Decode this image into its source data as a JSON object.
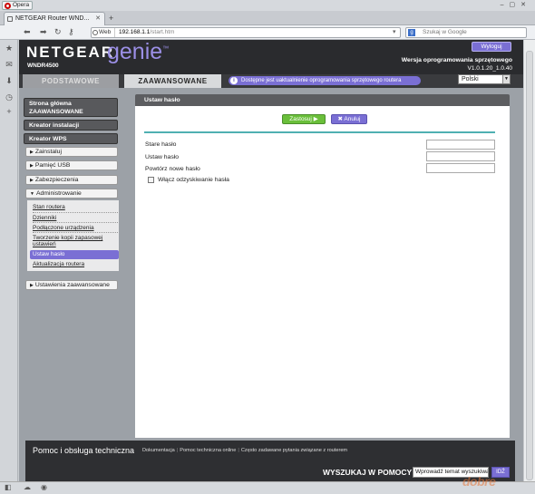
{
  "browser": {
    "menu_label": "Opera",
    "tab_title": "NETGEAR Router WND...",
    "nav_web_label": "Web",
    "url_host": "192.168.1.1",
    "url_path": "/start.htm",
    "search_placeholder": "Szukaj w Google"
  },
  "header": {
    "brand": "NETGEAR",
    "product": "genie",
    "model": "WNDR4500",
    "logout_label": "Wyloguj",
    "fw_label": "Wersja oprogramowania sprzętowego",
    "fw_version": "V1.0.1.20_1.0.40"
  },
  "tabs": {
    "basic": "PODSTAWOWE",
    "advanced": "ZAAWANSOWANE"
  },
  "update_notice": "Dostępne jest uaktualnienie oprogramowania sprzętowego routera",
  "language": "Polski",
  "sidebar": {
    "home": "Strona główna ZAAWANSOWANE",
    "setup_wizard": "Kreator instalacji",
    "wps_wizard": "Kreator WPS",
    "sections": [
      "Zainstaluj",
      "Pamięć USB",
      "Zabezpieczenia",
      "Administrowanie"
    ],
    "admin_items": [
      "Stan routera",
      "Dzienniki",
      "Podłączone urządzenia",
      "Tworzenie kopii zapasowej ustawień",
      "Ustaw hasło",
      "Aktualizacja routera"
    ],
    "advanced_settings": "Ustawienia zaawansowane"
  },
  "main": {
    "title": "Ustaw hasło",
    "apply_label": "Zastosuj",
    "cancel_label": "Anuluj",
    "old_password_label": "Stare hasło",
    "new_password_label": "Ustaw hasło",
    "repeat_password_label": "Powtórz nowe hasło",
    "recovery_label": "Włącz odzyskiwanie hasła",
    "old_password_value": "",
    "new_password_value": "",
    "repeat_password_value": "",
    "recovery_enabled": false
  },
  "footer": {
    "title": "Pomoc i obsługa techniczna",
    "links": [
      "Dokumentacja",
      "Pomoc techniczna online",
      "Często zadawane pytania związane z routerem"
    ],
    "search_label": "WYSZUKAJ W POMOCY",
    "search_placeholder": "Wprowadź temat wyszukiwania",
    "search_button": "IDŹ"
  },
  "watermark": "dobreprogramy"
}
